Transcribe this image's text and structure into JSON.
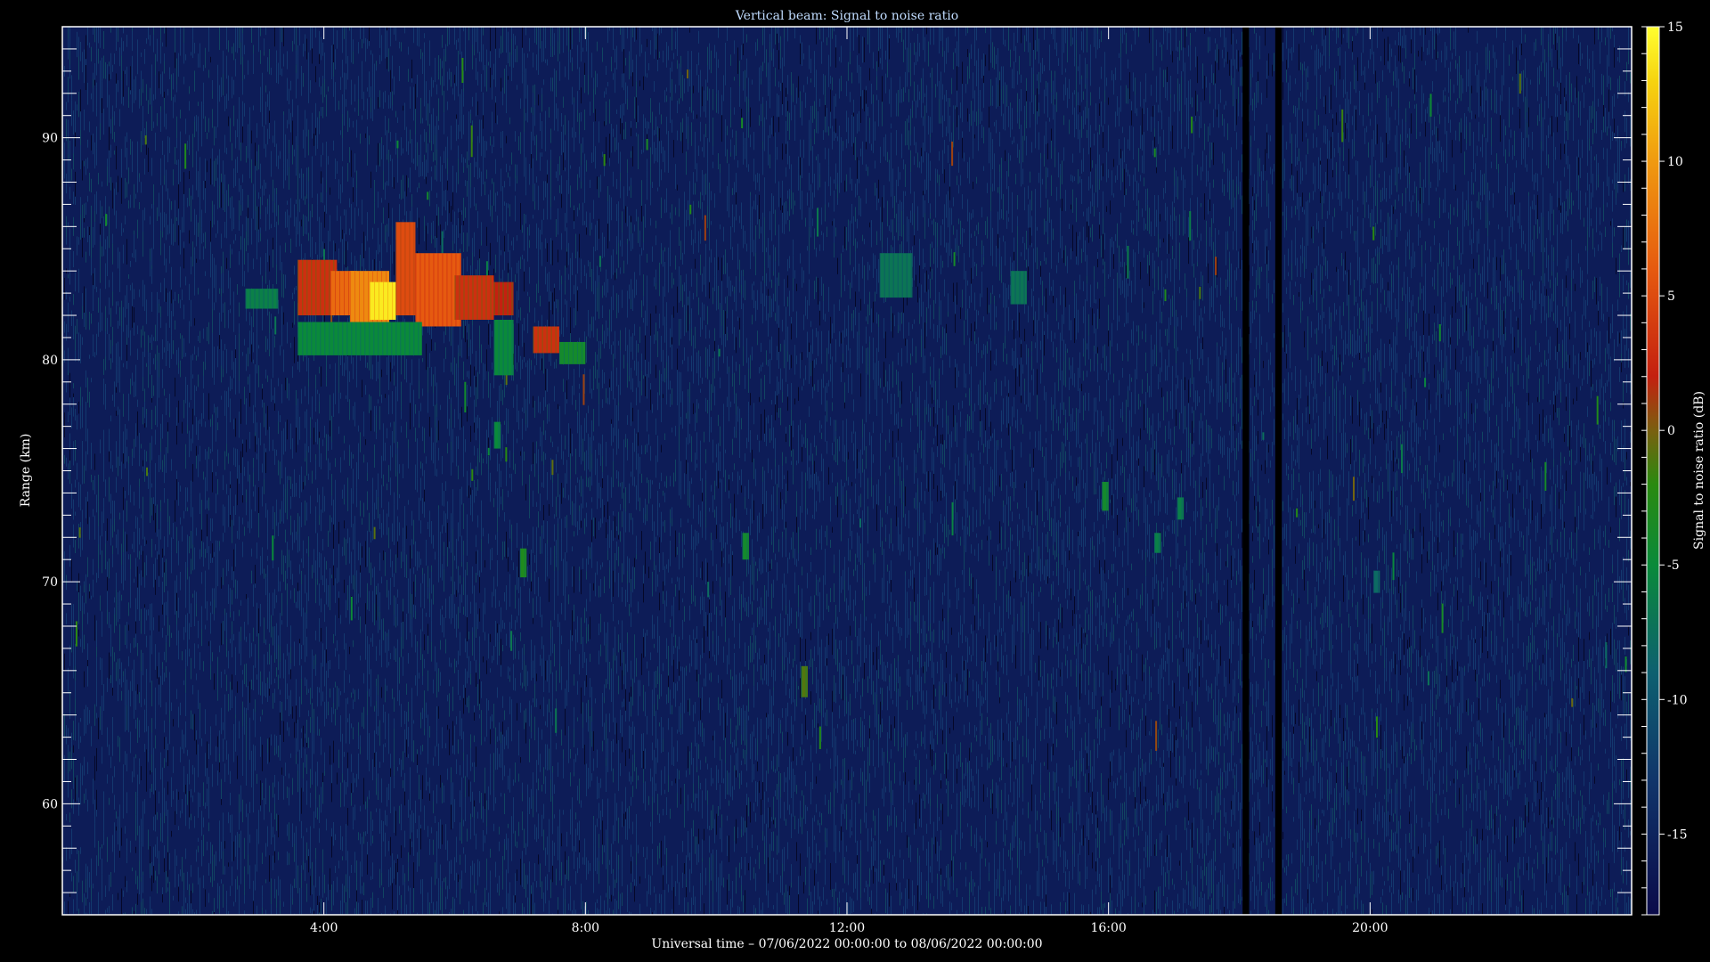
{
  "chart_data": {
    "type": "heatmap",
    "title": "Vertical beam: Signal to noise ratio",
    "xlabel": "Universal time – 07/06/2022 00:00:00 to 08/06/2022 00:00:00",
    "ylabel": "Range (km)",
    "colorbar_label": "Signal to noise ratio (dB)",
    "x_unit": "hours UT",
    "xlim": [
      0,
      24
    ],
    "ylim": [
      55,
      95
    ],
    "x_ticks": [
      {
        "value": 4,
        "label": "4:00"
      },
      {
        "value": 8,
        "label": "8:00"
      },
      {
        "value": 12,
        "label": "12:00"
      },
      {
        "value": 16,
        "label": "16:00"
      },
      {
        "value": 20,
        "label": "20:00"
      }
    ],
    "y_ticks": [
      {
        "value": 60,
        "label": "60"
      },
      {
        "value": 70,
        "label": "70"
      },
      {
        "value": 80,
        "label": "80"
      },
      {
        "value": 90,
        "label": "90"
      }
    ],
    "colorbar_range": [
      -18,
      15
    ],
    "colorbar_ticks": [
      {
        "value": 15,
        "label": "15"
      },
      {
        "value": 10,
        "label": "10"
      },
      {
        "value": 5,
        "label": "5"
      },
      {
        "value": 0,
        "label": "0"
      },
      {
        "value": -5,
        "label": "-5"
      },
      {
        "value": -10,
        "label": "-10"
      },
      {
        "value": -15,
        "label": "-15"
      }
    ],
    "background_snr_db": -16,
    "colormap": [
      {
        "value": -18,
        "color": "#0b0b4a"
      },
      {
        "value": -13,
        "color": "#10356a"
      },
      {
        "value": -9,
        "color": "#0e6070"
      },
      {
        "value": -5,
        "color": "#0a8a3a"
      },
      {
        "value": -2,
        "color": "#2a8a10"
      },
      {
        "value": 0,
        "color": "#7a6010"
      },
      {
        "value": 2,
        "color": "#c42010"
      },
      {
        "value": 6,
        "color": "#e65a10"
      },
      {
        "value": 10,
        "color": "#f09a10"
      },
      {
        "value": 13,
        "color": "#f6d410"
      },
      {
        "value": 15,
        "color": "#ffff30"
      }
    ],
    "data_gaps": [
      {
        "start": 18.05,
        "end": 18.15
      },
      {
        "start": 18.55,
        "end": 18.65
      }
    ],
    "echo_regions": [
      {
        "t0": 3.6,
        "t1": 4.2,
        "r0": 82.0,
        "r1": 84.5,
        "snr": 3
      },
      {
        "t0": 4.1,
        "t1": 4.5,
        "r0": 82.0,
        "r1": 84.0,
        "snr": 7
      },
      {
        "t0": 4.4,
        "t1": 5.0,
        "r0": 81.5,
        "r1": 84.0,
        "snr": 9
      },
      {
        "t0": 4.7,
        "t1": 5.1,
        "r0": 81.8,
        "r1": 83.5,
        "snr": 14
      },
      {
        "t0": 5.1,
        "t1": 5.4,
        "r0": 82.0,
        "r1": 86.2,
        "snr": 5
      },
      {
        "t0": 5.4,
        "t1": 6.1,
        "r0": 81.5,
        "r1": 84.8,
        "snr": 6
      },
      {
        "t0": 6.0,
        "t1": 6.6,
        "r0": 81.8,
        "r1": 83.8,
        "snr": 3
      },
      {
        "t0": 6.6,
        "t1": 6.9,
        "r0": 82.0,
        "r1": 83.5,
        "snr": 2
      },
      {
        "t0": 3.6,
        "t1": 5.5,
        "r0": 80.2,
        "r1": 81.7,
        "snr": -5
      },
      {
        "t0": 6.6,
        "t1": 6.9,
        "r0": 79.3,
        "r1": 81.8,
        "snr": -5
      },
      {
        "t0": 2.8,
        "t1": 3.3,
        "r0": 82.3,
        "r1": 83.2,
        "snr": -6
      },
      {
        "t0": 7.2,
        "t1": 7.6,
        "r0": 80.3,
        "r1": 81.5,
        "snr": 3
      },
      {
        "t0": 7.6,
        "t1": 8.0,
        "r0": 79.8,
        "r1": 80.8,
        "snr": -4
      },
      {
        "t0": 12.5,
        "t1": 13.0,
        "r0": 82.8,
        "r1": 84.8,
        "snr": -7
      },
      {
        "t0": 14.5,
        "t1": 14.75,
        "r0": 82.5,
        "r1": 84.0,
        "snr": -7
      },
      {
        "t0": 6.6,
        "t1": 6.7,
        "r0": 76.0,
        "r1": 77.2,
        "snr": -5
      },
      {
        "t0": 7.0,
        "t1": 7.1,
        "r0": 70.2,
        "r1": 71.5,
        "snr": -3
      },
      {
        "t0": 10.4,
        "t1": 10.5,
        "r0": 71.0,
        "r1": 72.2,
        "snr": -4
      },
      {
        "t0": 11.3,
        "t1": 11.4,
        "r0": 64.8,
        "r1": 66.2,
        "snr": -1
      },
      {
        "t0": 15.9,
        "t1": 16.0,
        "r0": 73.2,
        "r1": 74.5,
        "snr": -4
      },
      {
        "t0": 16.7,
        "t1": 16.8,
        "r0": 71.3,
        "r1": 72.2,
        "snr": -6
      },
      {
        "t0": 17.05,
        "t1": 17.15,
        "r0": 72.8,
        "r1": 73.8,
        "snr": -6
      },
      {
        "t0": 20.05,
        "t1": 20.15,
        "r0": 69.5,
        "r1": 70.5,
        "snr": -8
      }
    ]
  }
}
